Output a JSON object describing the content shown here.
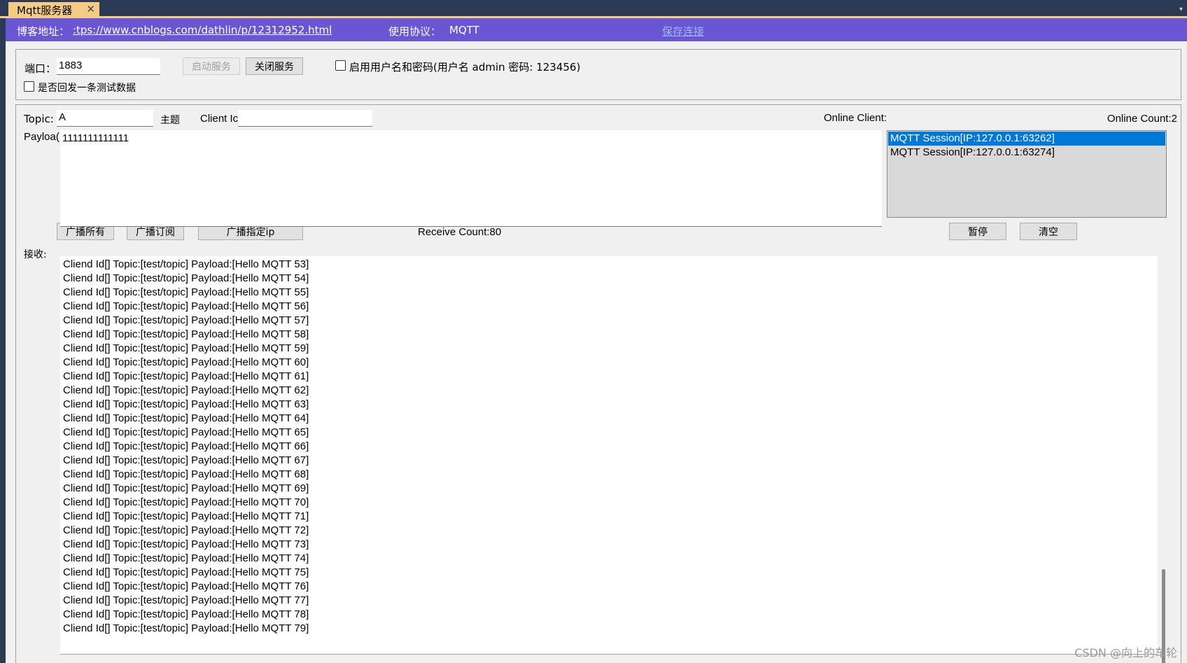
{
  "tab": {
    "title": "Mqtt服务器",
    "close": "✕",
    "overflow": "▾"
  },
  "infobar": {
    "blog_label": "博客地址：",
    "blog_url": ":tps://www.cnblogs.com/dathlin/p/12312952.html",
    "protocol_label": "使用协议：",
    "protocol_value": "MQTT",
    "save_link": "保存连接"
  },
  "server": {
    "port_label": "端口：",
    "port_value": "1883",
    "start_button": "启动服务",
    "stop_button": "关闭服务",
    "auth_checkbox_label": "启用用户名和密码(用户名 admin  密码: 123456)",
    "auth_checked": false,
    "reply_checkbox_label": "是否回发一条测试数据",
    "reply_checked": false
  },
  "publish": {
    "topic_label": "Topic:",
    "topic_value": "A",
    "topic_hint": "主题",
    "client_id_label": "Client Ic",
    "client_id_value": "",
    "payload_label": "Payloa(",
    "payload_value": "1111111111111",
    "broadcast_all": "广播所有",
    "broadcast_subscribe": "广播订阅",
    "broadcast_ip": "广播指定ip",
    "receive_count": "Receive Count:80",
    "pause_button": "暂停",
    "clear_button": "清空"
  },
  "online": {
    "label": "Online Client:",
    "count": "Online Count:2",
    "clients": [
      "MQTT Session[IP:127.0.0.1:63262]",
      "MQTT Session[IP:127.0.0.1:63274]"
    ],
    "selected_index": 0
  },
  "receive": {
    "label": "接收:",
    "lines": [
      "Cliend Id[] Topic:[test/topic] Payload:[Hello MQTT 53]",
      "Cliend Id[] Topic:[test/topic] Payload:[Hello MQTT 54]",
      "Cliend Id[] Topic:[test/topic] Payload:[Hello MQTT 55]",
      "Cliend Id[] Topic:[test/topic] Payload:[Hello MQTT 56]",
      "Cliend Id[] Topic:[test/topic] Payload:[Hello MQTT 57]",
      "Cliend Id[] Topic:[test/topic] Payload:[Hello MQTT 58]",
      "Cliend Id[] Topic:[test/topic] Payload:[Hello MQTT 59]",
      "Cliend Id[] Topic:[test/topic] Payload:[Hello MQTT 60]",
      "Cliend Id[] Topic:[test/topic] Payload:[Hello MQTT 61]",
      "Cliend Id[] Topic:[test/topic] Payload:[Hello MQTT 62]",
      "Cliend Id[] Topic:[test/topic] Payload:[Hello MQTT 63]",
      "Cliend Id[] Topic:[test/topic] Payload:[Hello MQTT 64]",
      "Cliend Id[] Topic:[test/topic] Payload:[Hello MQTT 65]",
      "Cliend Id[] Topic:[test/topic] Payload:[Hello MQTT 66]",
      "Cliend Id[] Topic:[test/topic] Payload:[Hello MQTT 67]",
      "Cliend Id[] Topic:[test/topic] Payload:[Hello MQTT 68]",
      "Cliend Id[] Topic:[test/topic] Payload:[Hello MQTT 69]",
      "Cliend Id[] Topic:[test/topic] Payload:[Hello MQTT 70]",
      "Cliend Id[] Topic:[test/topic] Payload:[Hello MQTT 71]",
      "Cliend Id[] Topic:[test/topic] Payload:[Hello MQTT 72]",
      "Cliend Id[] Topic:[test/topic] Payload:[Hello MQTT 73]",
      "Cliend Id[] Topic:[test/topic] Payload:[Hello MQTT 74]",
      "Cliend Id[] Topic:[test/topic] Payload:[Hello MQTT 75]",
      "Cliend Id[] Topic:[test/topic] Payload:[Hello MQTT 76]",
      "Cliend Id[] Topic:[test/topic] Payload:[Hello MQTT 77]",
      "Cliend Id[] Topic:[test/topic] Payload:[Hello MQTT 78]",
      "Cliend Id[] Topic:[test/topic] Payload:[Hello MQTT 79]"
    ]
  },
  "watermark": "CSDN @向上的车轮"
}
